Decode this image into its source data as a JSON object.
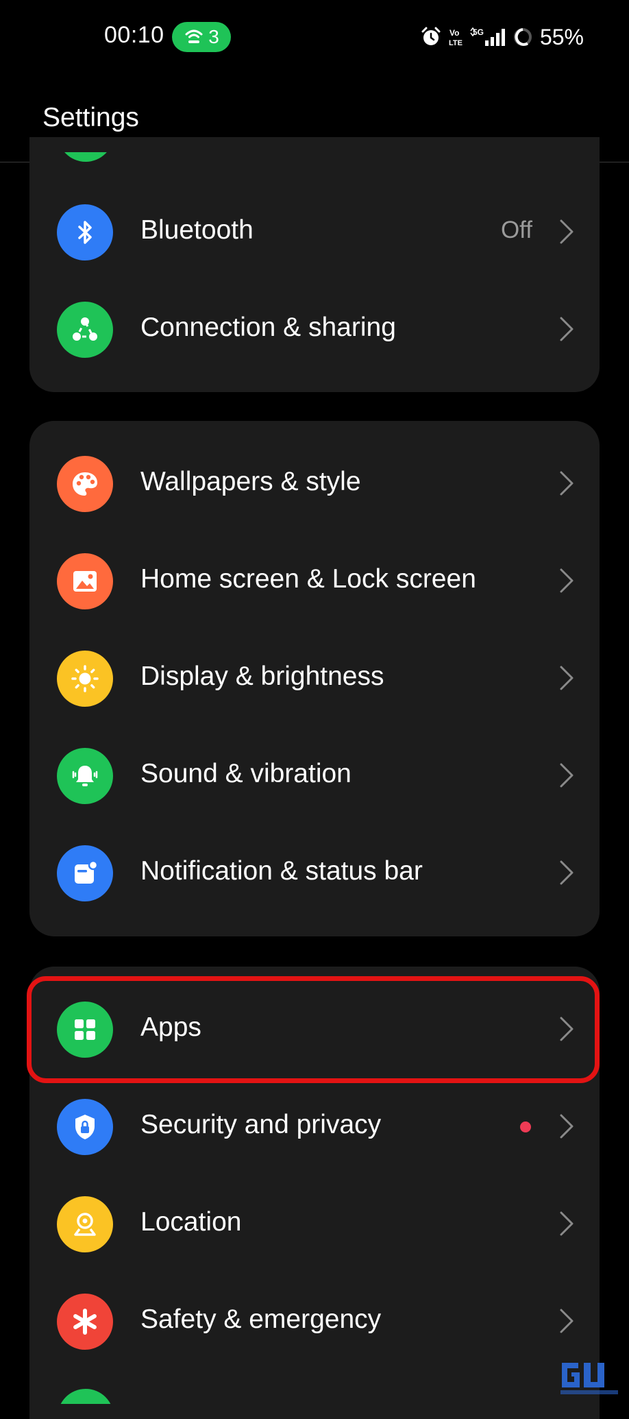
{
  "status_bar": {
    "time": "00:10",
    "hotspot_count": "3",
    "battery": "55%",
    "icons": [
      "hotspot-icon",
      "alarm-icon",
      "volte-icon",
      "5g-signal-icon",
      "battery-ring-icon"
    ]
  },
  "header": {
    "title": "Settings"
  },
  "groups": [
    {
      "items": [
        {
          "label": "Bluetooth",
          "value": "Off",
          "icon": "bluetooth-icon",
          "color": "#2f7cf6"
        },
        {
          "label": "Connection & sharing",
          "icon": "share-icon",
          "color": "#1fc357"
        }
      ]
    },
    {
      "items": [
        {
          "label": "Wallpapers & style",
          "icon": "palette-icon",
          "color": "#ff6a3d"
        },
        {
          "label": "Home screen & Lock screen",
          "icon": "image-icon",
          "color": "#ff6a3d"
        },
        {
          "label": "Display & brightness",
          "icon": "sun-icon",
          "color": "#fbc324"
        },
        {
          "label": "Sound & vibration",
          "icon": "bell-icon",
          "color": "#1fc357"
        },
        {
          "label": "Notification & status bar",
          "icon": "notification-icon",
          "color": "#2f7cf6"
        }
      ]
    },
    {
      "items": [
        {
          "label": "Apps",
          "icon": "apps-grid-icon",
          "color": "#1fc357",
          "highlighted": true
        },
        {
          "label": "Security and privacy",
          "icon": "shield-lock-icon",
          "color": "#2f7cf6",
          "badge": "red-dot"
        },
        {
          "label": "Location",
          "icon": "location-pin-icon",
          "color": "#fbc324"
        },
        {
          "label": "Safety & emergency",
          "icon": "asterisk-icon",
          "color": "#f04438"
        }
      ]
    }
  ],
  "colors": {
    "background": "#000000",
    "card": "#1c1c1c",
    "highlight_border": "#e31313",
    "secondary_text": "#9a9a9a",
    "badge_dot": "#ee3b55"
  }
}
